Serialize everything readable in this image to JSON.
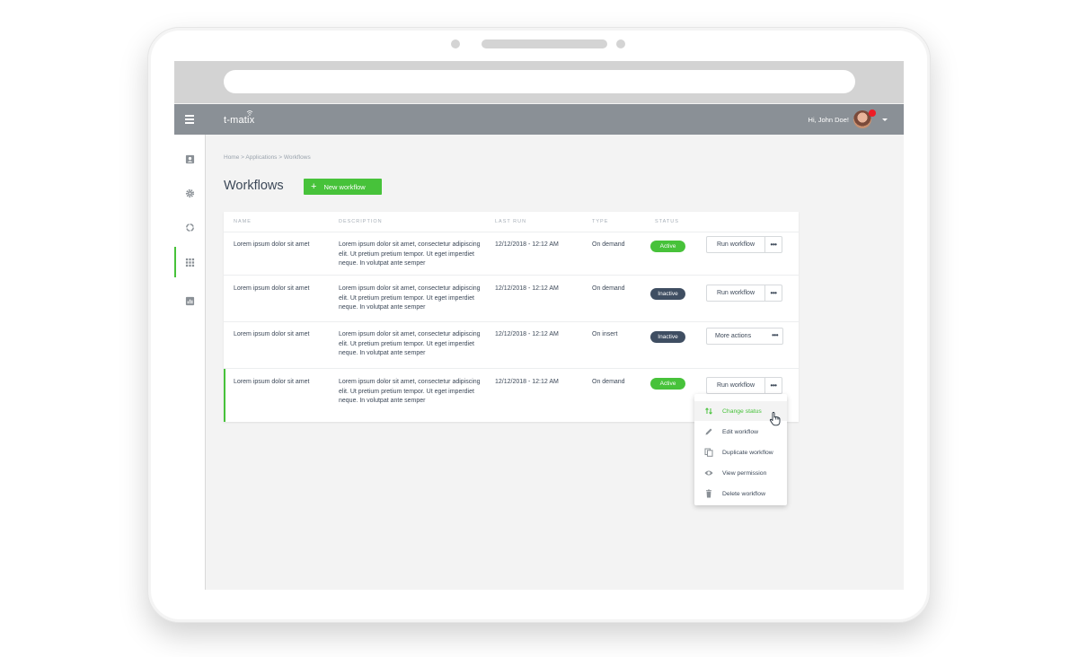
{
  "app": {
    "logo": "t-matix",
    "greeting": "Hi, John Doe!"
  },
  "breadcrumb": "Home > Applications > Workflows",
  "page": {
    "title": "Workflows",
    "new_button": "New workflow"
  },
  "table": {
    "columns": [
      "NAME",
      "DESCRIPTION",
      "LAST RUN",
      "TYPE",
      "STATUS"
    ],
    "rows": [
      {
        "name": "Lorem ipsum dolor sit amet",
        "description": "Lorem ipsum dolor sit amet, consectetur adipiscing elit. Ut pretium pretium tempor. Ut eget imperdiet neque. In volutpat ante semper",
        "last_run": "12/12/2018 - 12:12 AM",
        "type": "On demand",
        "status": "Active",
        "action": "Run workflow"
      },
      {
        "name": "Lorem ipsum dolor sit amet",
        "description": "Lorem ipsum dolor sit amet, consectetur adipiscing elit. Ut pretium pretium tempor. Ut eget imperdiet neque. In volutpat ante semper",
        "last_run": "12/12/2018 - 12:12 AM",
        "type": "On demand",
        "status": "Inactive",
        "action": "Run workflow"
      },
      {
        "name": "Lorem ipsum dolor sit amet",
        "description": "Lorem ipsum dolor sit amet, consectetur adipiscing elit. Ut pretium pretium tempor. Ut eget imperdiet neque. In volutpat ante semper",
        "last_run": "12/12/2018 - 12:12 AM",
        "type": "On insert",
        "status": "Inactive",
        "action": "More actions"
      },
      {
        "name": "Lorem ipsum dolor sit amet",
        "description": "Lorem ipsum dolor sit amet, consectetur adipiscing elit. Ut pretium pretium tempor. Ut eget imperdiet neque. In volutpat ante semper",
        "last_run": "12/12/2018 - 12:12 AM",
        "type": "On demand",
        "status": "Active",
        "action": "Run workflow"
      }
    ]
  },
  "dropdown": {
    "items": [
      "Change status",
      "Edit workflow",
      "Duplicate workflow",
      "View permission",
      "Delete workflow"
    ]
  },
  "icons": {
    "sidebar": [
      "contact-card-icon",
      "gear-icon",
      "circle-progress-icon",
      "apps-grid-icon",
      "bar-chart-icon"
    ],
    "dropdown": [
      "swap-vertical-icon",
      "pencil-icon",
      "copy-icon",
      "eye-icon",
      "trash-icon"
    ]
  },
  "colors": {
    "accent": "#47c23a",
    "header": "#8a9096",
    "inactive_badge": "#3f4e62",
    "notification": "#ee1c25"
  }
}
